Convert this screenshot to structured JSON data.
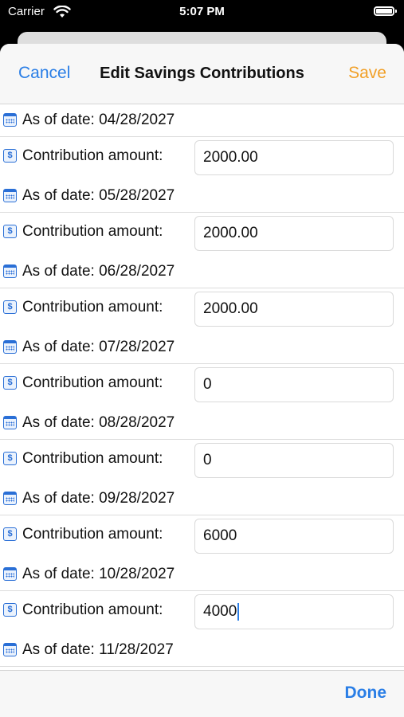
{
  "status_bar": {
    "carrier": "Carrier",
    "time": "5:07 PM"
  },
  "nav": {
    "cancel_label": "Cancel",
    "title": "Edit Savings Contributions",
    "save_label": "Save"
  },
  "rows": [
    {
      "type": "date",
      "label": "As of date: 04/28/2027"
    },
    {
      "type": "amount",
      "label": "Contribution amount:",
      "value": "2000.00"
    },
    {
      "type": "date",
      "label": "As of date: 05/28/2027"
    },
    {
      "type": "amount",
      "label": "Contribution amount:",
      "value": "2000.00"
    },
    {
      "type": "date",
      "label": "As of date: 06/28/2027"
    },
    {
      "type": "amount",
      "label": "Contribution amount:",
      "value": "2000.00"
    },
    {
      "type": "date",
      "label": "As of date: 07/28/2027"
    },
    {
      "type": "amount",
      "label": "Contribution amount:",
      "value": "0"
    },
    {
      "type": "date",
      "label": "As of date: 08/28/2027"
    },
    {
      "type": "amount",
      "label": "Contribution amount:",
      "value": "0"
    },
    {
      "type": "date",
      "label": "As of date: 09/28/2027"
    },
    {
      "type": "amount",
      "label": "Contribution amount:",
      "value": "6000"
    },
    {
      "type": "date",
      "label": "As of date: 10/28/2027"
    },
    {
      "type": "amount",
      "label": "Contribution amount:",
      "value": "4000",
      "focused": true
    },
    {
      "type": "date",
      "label": "As of date: 11/28/2027"
    }
  ],
  "icons": {
    "date": "calendar-icon",
    "amount": "dollar-icon",
    "amount_glyph": "$"
  },
  "toolbar": {
    "done_label": "Done"
  },
  "colors": {
    "accent_blue": "#2a7ee6",
    "save_orange": "#f1a028"
  }
}
